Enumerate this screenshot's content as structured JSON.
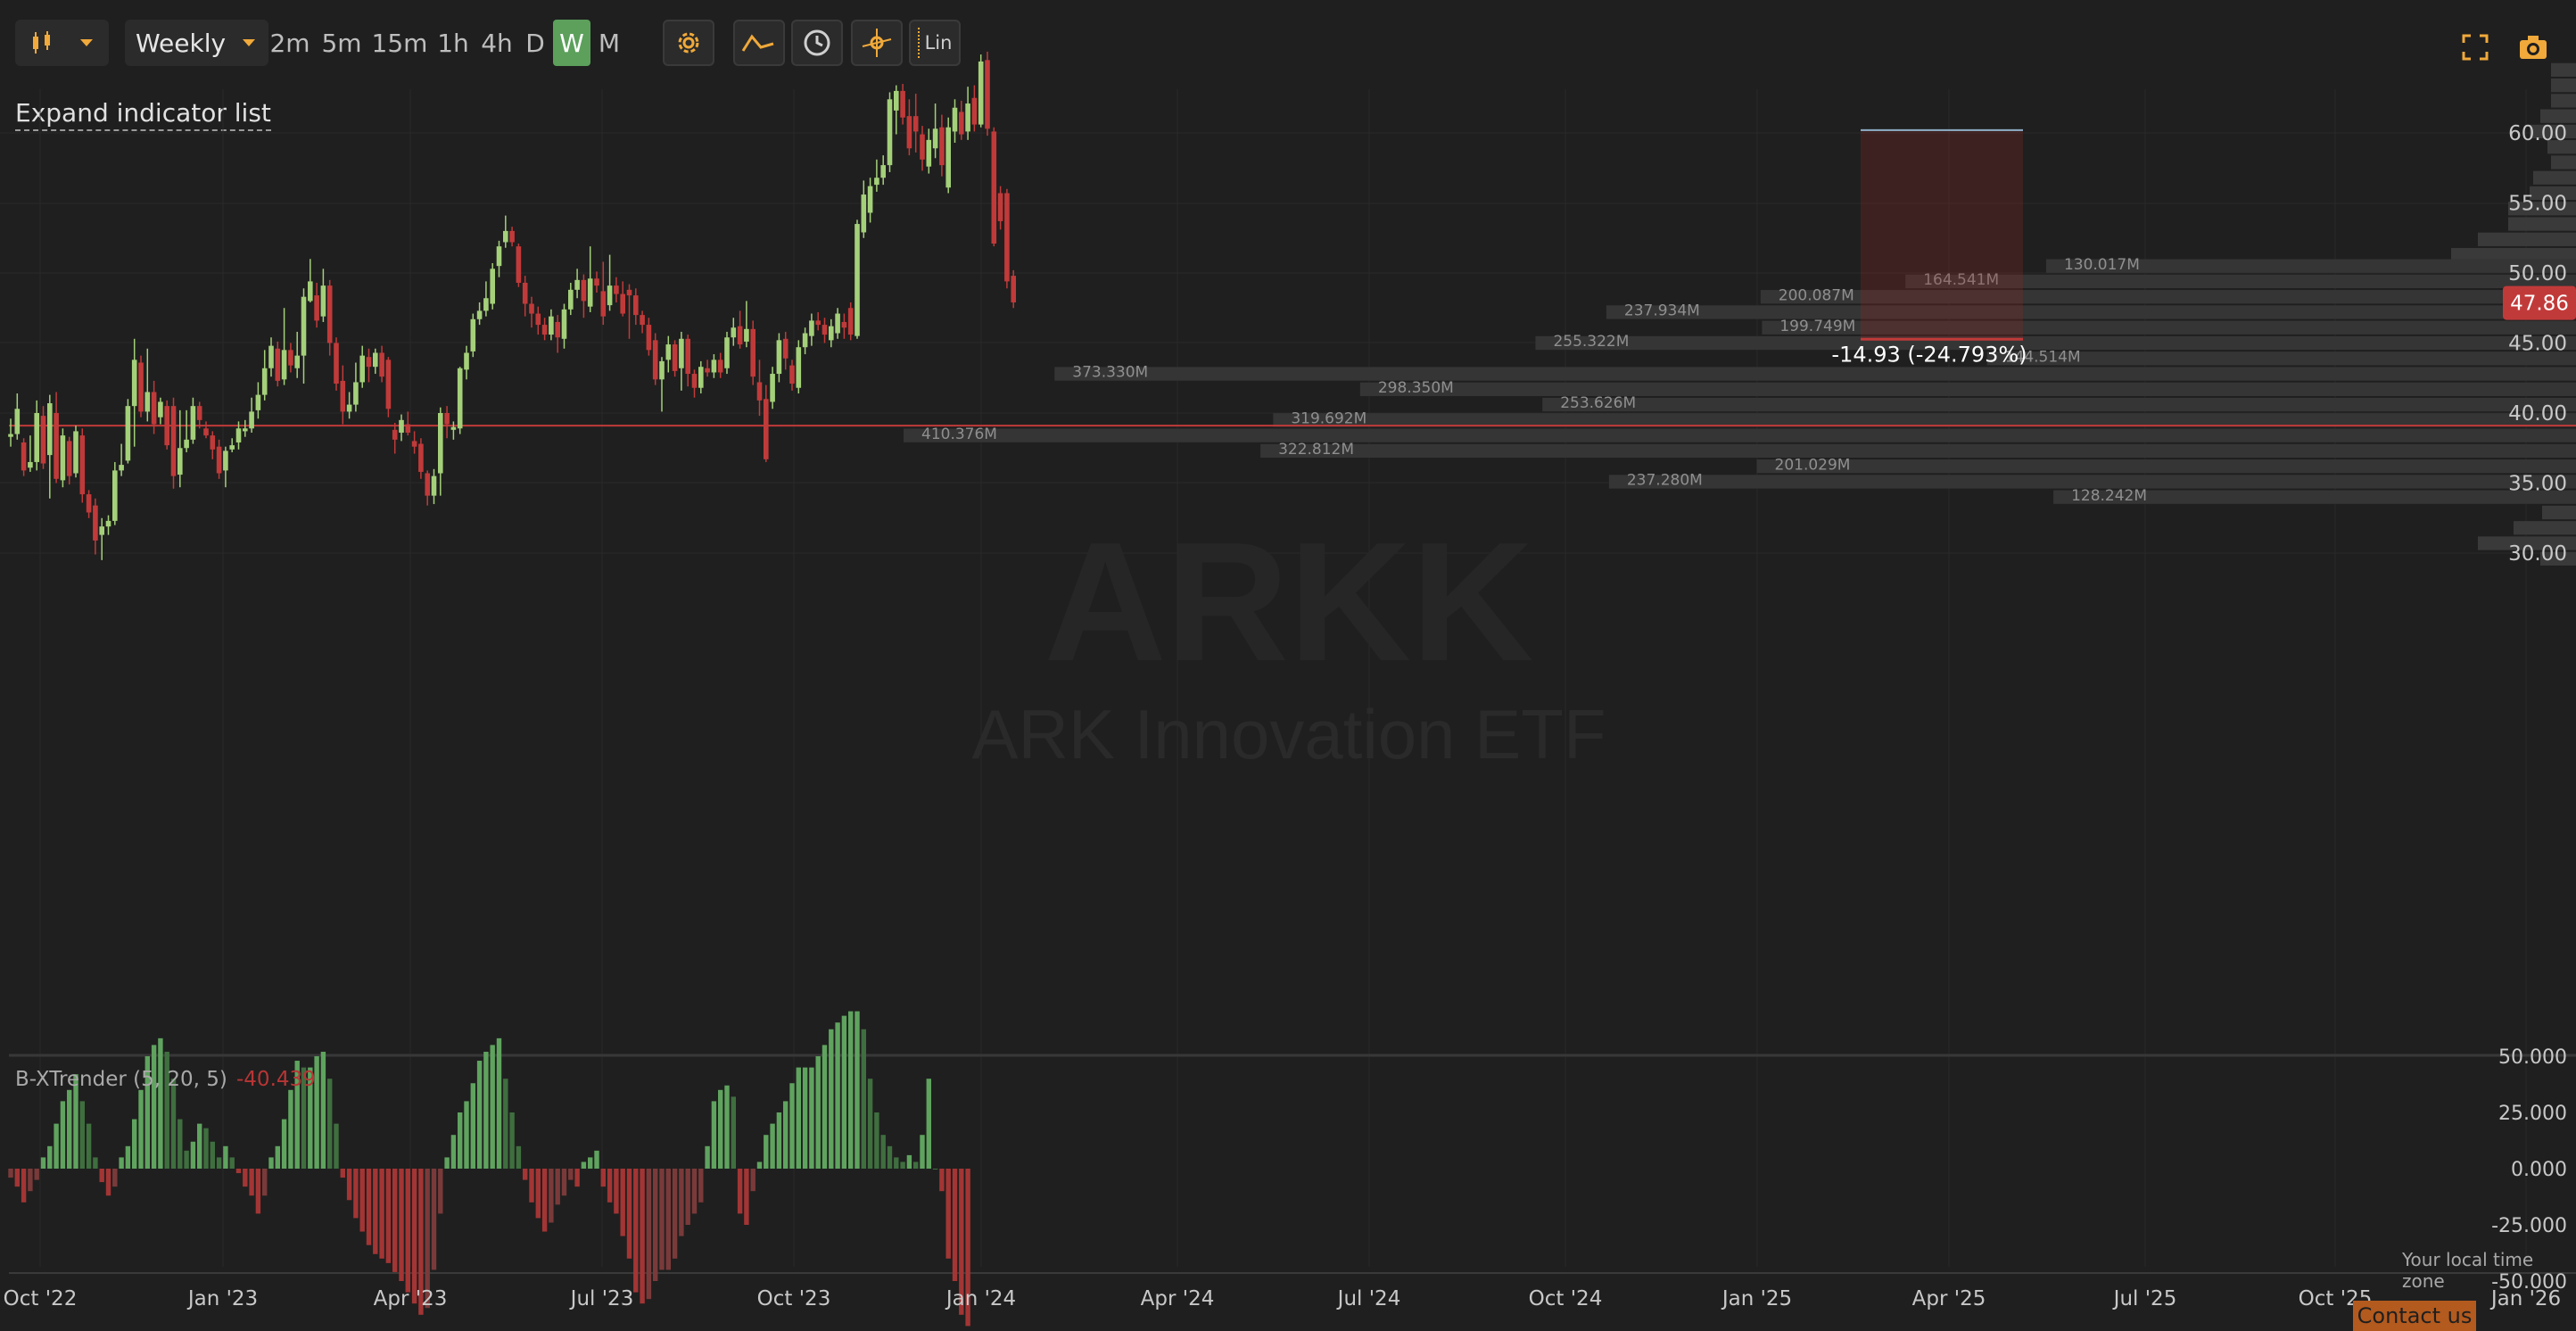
{
  "toolbar": {
    "interval_select": "Weekly",
    "intervals": [
      "2m",
      "5m",
      "15m",
      "1h",
      "4h",
      "D",
      "W",
      "M"
    ],
    "active_interval": "W",
    "scale_button": "Lin"
  },
  "expand_indicators_label": "Expand indicator list",
  "watermark": {
    "symbol": "ARKK",
    "name": "ARK Innovation ETF"
  },
  "price_axis": {
    "ticks": [
      "60.00",
      "55.00",
      "50.00",
      "45.00",
      "40.00",
      "35.00",
      "30.00"
    ]
  },
  "last_price": "47.86",
  "measure_label": "-14.93 (-24.793%)",
  "volume_profile_labels": [
    "130.017M",
    "164.541M",
    "200.087M",
    "237.934M",
    "199.749M",
    "255.322M",
    "144.514M",
    "373.330M",
    "298.350M",
    "253.626M",
    "319.692M",
    "410.376M",
    "322.812M",
    "201.029M",
    "237.280M",
    "128.242M"
  ],
  "indicator": {
    "label": "B-XTrender (5, 20, 5)",
    "value": "-40.439",
    "ticks": [
      "50.000",
      "25.000",
      "0.000",
      "-25.000",
      "-50.000"
    ]
  },
  "time_axis": [
    "Oct '22",
    "Jan '23",
    "Apr '23",
    "Jul '23",
    "Oct '23",
    "Jan '24",
    "Apr '24",
    "Jul '24",
    "Oct '24",
    "Jan '25",
    "Apr '25",
    "Jul '25",
    "Oct '25",
    "Jan '26"
  ],
  "timezone_label": "Your local time zone",
  "contact_label": "Contact us",
  "colors": {
    "up": "#a4d07a",
    "down": "#c13a3a",
    "bg": "#1f1f1f",
    "accent": "#f0a93a",
    "active": "#5ca05c"
  },
  "icons": [
    "candlestick-icon",
    "chevron-down-icon",
    "gear-icon",
    "draw-line-icon",
    "clock-icon",
    "crosshair-icon",
    "fullscreen-icon",
    "camera-icon"
  ],
  "chart_data": {
    "type": "candlestick",
    "interval": "weekly",
    "y_range": [
      29,
      64
    ],
    "weeks": [
      {
        "o": 38.3,
        "c": 38.5,
        "h": 39.6,
        "l": 37.6
      },
      {
        "o": 38.5,
        "c": 40.3,
        "h": 41.4,
        "l": 38.1
      },
      {
        "o": 37.9,
        "c": 35.9,
        "h": 38.2,
        "l": 35.5
      },
      {
        "o": 36.1,
        "c": 36.5,
        "h": 38.4,
        "l": 35.8
      },
      {
        "o": 36.5,
        "c": 40.0,
        "h": 40.9,
        "l": 35.9
      },
      {
        "o": 39.8,
        "c": 36.4,
        "h": 40.5,
        "l": 36.0
      },
      {
        "o": 37.0,
        "c": 40.7,
        "h": 41.3,
        "l": 33.9
      },
      {
        "o": 40.0,
        "c": 35.3,
        "h": 41.5,
        "l": 35.0
      },
      {
        "o": 35.2,
        "c": 38.4,
        "h": 38.9,
        "l": 34.7
      },
      {
        "o": 38.0,
        "c": 35.5,
        "h": 38.3,
        "l": 34.9
      },
      {
        "o": 35.7,
        "c": 38.7,
        "h": 39.1,
        "l": 35.4
      },
      {
        "o": 38.4,
        "c": 34.2,
        "h": 38.9,
        "l": 33.6
      },
      {
        "o": 34.2,
        "c": 32.9,
        "h": 34.5,
        "l": 32.5
      },
      {
        "o": 33.4,
        "c": 30.9,
        "h": 33.9,
        "l": 29.9
      },
      {
        "o": 31.3,
        "c": 31.9,
        "h": 32.5,
        "l": 29.5
      },
      {
        "o": 31.9,
        "c": 32.3,
        "h": 32.7,
        "l": 31.3
      },
      {
        "o": 32.3,
        "c": 35.9,
        "h": 36.5,
        "l": 32.0
      },
      {
        "o": 35.9,
        "c": 36.3,
        "h": 37.8,
        "l": 35.5
      },
      {
        "o": 36.6,
        "c": 40.5,
        "h": 41.0,
        "l": 36.4
      },
      {
        "o": 40.5,
        "c": 43.8,
        "h": 45.3,
        "l": 37.6
      },
      {
        "o": 43.6,
        "c": 40.1,
        "h": 44.1,
        "l": 39.7
      },
      {
        "o": 40.1,
        "c": 41.5,
        "h": 44.6,
        "l": 39.4
      },
      {
        "o": 41.5,
        "c": 39.2,
        "h": 42.3,
        "l": 38.5
      },
      {
        "o": 39.7,
        "c": 40.8,
        "h": 41.1,
        "l": 39.2
      },
      {
        "o": 40.5,
        "c": 37.7,
        "h": 40.9,
        "l": 37.4
      },
      {
        "o": 40.5,
        "c": 35.5,
        "h": 41.1,
        "l": 34.6
      },
      {
        "o": 35.6,
        "c": 37.5,
        "h": 40.2,
        "l": 34.7
      },
      {
        "o": 37.5,
        "c": 38.1,
        "h": 40.2,
        "l": 37.2
      },
      {
        "o": 38.1,
        "c": 40.5,
        "h": 41.1,
        "l": 37.8
      },
      {
        "o": 40.5,
        "c": 39.5,
        "h": 40.8,
        "l": 38.9
      },
      {
        "o": 38.9,
        "c": 38.4,
        "h": 39.4,
        "l": 38.2
      },
      {
        "o": 38.4,
        "c": 37.4,
        "h": 38.7,
        "l": 36.7
      },
      {
        "o": 37.6,
        "c": 35.7,
        "h": 38.1,
        "l": 35.3
      },
      {
        "o": 35.9,
        "c": 37.3,
        "h": 37.6,
        "l": 34.7
      },
      {
        "o": 37.4,
        "c": 37.7,
        "h": 38.2,
        "l": 37.2
      },
      {
        "o": 37.9,
        "c": 38.9,
        "h": 39.4,
        "l": 37.4
      },
      {
        "o": 38.7,
        "c": 38.9,
        "h": 39.5,
        "l": 38.3
      },
      {
        "o": 38.9,
        "c": 40.1,
        "h": 41.1,
        "l": 38.6
      },
      {
        "o": 40.2,
        "c": 41.3,
        "h": 42.2,
        "l": 39.6
      },
      {
        "o": 41.3,
        "c": 43.2,
        "h": 44.5,
        "l": 40.9
      },
      {
        "o": 43.2,
        "c": 44.8,
        "h": 45.4,
        "l": 42.6
      },
      {
        "o": 44.6,
        "c": 42.3,
        "h": 45.1,
        "l": 41.9
      },
      {
        "o": 42.4,
        "c": 44.5,
        "h": 47.5,
        "l": 42.0
      },
      {
        "o": 44.5,
        "c": 43.4,
        "h": 45.0,
        "l": 42.9
      },
      {
        "o": 43.2,
        "c": 44.1,
        "h": 45.8,
        "l": 42.5
      },
      {
        "o": 44.1,
        "c": 48.3,
        "h": 48.9,
        "l": 42.1
      },
      {
        "o": 48.0,
        "c": 49.4,
        "h": 51.0,
        "l": 47.9
      },
      {
        "o": 48.4,
        "c": 46.6,
        "h": 49.3,
        "l": 46.1
      },
      {
        "o": 46.9,
        "c": 49.1,
        "h": 50.3,
        "l": 46.5
      },
      {
        "o": 49.1,
        "c": 45.0,
        "h": 49.5,
        "l": 44.1
      },
      {
        "o": 45.0,
        "c": 42.1,
        "h": 45.4,
        "l": 41.6
      },
      {
        "o": 42.3,
        "c": 40.1,
        "h": 43.4,
        "l": 39.2
      },
      {
        "o": 40.1,
        "c": 40.6,
        "h": 41.5,
        "l": 39.6
      },
      {
        "o": 40.6,
        "c": 42.2,
        "h": 43.6,
        "l": 40.1
      },
      {
        "o": 42.2,
        "c": 44.1,
        "h": 44.8,
        "l": 41.8
      },
      {
        "o": 44.0,
        "c": 43.3,
        "h": 44.6,
        "l": 42.2
      },
      {
        "o": 43.3,
        "c": 44.3,
        "h": 44.6,
        "l": 42.8
      },
      {
        "o": 44.3,
        "c": 42.6,
        "h": 44.8,
        "l": 42.2
      },
      {
        "o": 43.8,
        "c": 40.3,
        "h": 44.0,
        "l": 39.7
      },
      {
        "o": 38.8,
        "c": 38.1,
        "h": 39.3,
        "l": 37.1
      },
      {
        "o": 38.6,
        "c": 39.5,
        "h": 39.9,
        "l": 38.0
      },
      {
        "o": 39.2,
        "c": 38.6,
        "h": 40.1,
        "l": 38.4
      },
      {
        "o": 38.0,
        "c": 37.6,
        "h": 38.7,
        "l": 37.1
      },
      {
        "o": 37.8,
        "c": 35.8,
        "h": 38.2,
        "l": 35.3
      },
      {
        "o": 35.7,
        "c": 34.1,
        "h": 35.9,
        "l": 33.4
      },
      {
        "o": 34.1,
        "c": 35.5,
        "h": 36.0,
        "l": 33.5
      },
      {
        "o": 35.7,
        "c": 40.0,
        "h": 40.4,
        "l": 34.1
      },
      {
        "o": 40.0,
        "c": 39.2,
        "h": 40.5,
        "l": 38.2
      },
      {
        "o": 38.8,
        "c": 39.0,
        "h": 39.4,
        "l": 38.1
      },
      {
        "o": 38.9,
        "c": 43.2,
        "h": 43.3,
        "l": 38.5
      },
      {
        "o": 43.1,
        "c": 44.3,
        "h": 44.8,
        "l": 42.4
      },
      {
        "o": 44.4,
        "c": 46.7,
        "h": 47.1,
        "l": 44.0
      },
      {
        "o": 46.7,
        "c": 47.3,
        "h": 47.9,
        "l": 46.3
      },
      {
        "o": 47.3,
        "c": 48.2,
        "h": 49.4,
        "l": 46.9
      },
      {
        "o": 47.8,
        "c": 50.3,
        "h": 50.7,
        "l": 47.4
      },
      {
        "o": 50.5,
        "c": 51.9,
        "h": 52.3,
        "l": 49.7
      },
      {
        "o": 52.2,
        "c": 53.0,
        "h": 54.1,
        "l": 51.8
      },
      {
        "o": 53.0,
        "c": 52.2,
        "h": 53.3,
        "l": 51.9
      },
      {
        "o": 51.9,
        "c": 49.3,
        "h": 52.1,
        "l": 49.0
      },
      {
        "o": 49.3,
        "c": 47.8,
        "h": 49.8,
        "l": 46.9
      },
      {
        "o": 47.8,
        "c": 47.1,
        "h": 48.3,
        "l": 46.1
      },
      {
        "o": 47.1,
        "c": 46.3,
        "h": 47.6,
        "l": 45.6
      },
      {
        "o": 46.3,
        "c": 45.6,
        "h": 46.8,
        "l": 45.2
      },
      {
        "o": 45.6,
        "c": 46.9,
        "h": 47.4,
        "l": 45.2
      },
      {
        "o": 46.5,
        "c": 45.4,
        "h": 47.0,
        "l": 44.3
      },
      {
        "o": 45.3,
        "c": 47.4,
        "h": 47.8,
        "l": 44.6
      },
      {
        "o": 47.4,
        "c": 48.8,
        "h": 49.3,
        "l": 47.0
      },
      {
        "o": 48.8,
        "c": 49.5,
        "h": 50.3,
        "l": 48.2
      },
      {
        "o": 49.5,
        "c": 48.0,
        "h": 49.9,
        "l": 46.8
      },
      {
        "o": 47.6,
        "c": 49.6,
        "h": 51.9,
        "l": 47.2
      },
      {
        "o": 49.6,
        "c": 49.1,
        "h": 50.1,
        "l": 48.6
      },
      {
        "o": 48.7,
        "c": 46.9,
        "h": 50.8,
        "l": 46.3
      },
      {
        "o": 47.7,
        "c": 49.1,
        "h": 51.3,
        "l": 47.3
      },
      {
        "o": 49.1,
        "c": 48.5,
        "h": 49.7,
        "l": 47.9
      },
      {
        "o": 48.5,
        "c": 47.1,
        "h": 49.4,
        "l": 46.9
      },
      {
        "o": 48.8,
        "c": 48.4,
        "h": 49.2,
        "l": 45.3
      },
      {
        "o": 48.4,
        "c": 47.0,
        "h": 48.9,
        "l": 46.3
      },
      {
        "o": 47.0,
        "c": 46.3,
        "h": 47.3,
        "l": 45.7
      },
      {
        "o": 46.3,
        "c": 44.5,
        "h": 46.8,
        "l": 44.1
      },
      {
        "o": 45.2,
        "c": 42.4,
        "h": 45.7,
        "l": 42.0
      },
      {
        "o": 42.4,
        "c": 43.7,
        "h": 44.0,
        "l": 40.1
      },
      {
        "o": 43.8,
        "c": 44.9,
        "h": 45.5,
        "l": 42.9
      },
      {
        "o": 44.9,
        "c": 43.0,
        "h": 45.2,
        "l": 42.6
      },
      {
        "o": 43.2,
        "c": 45.3,
        "h": 45.8,
        "l": 41.6
      },
      {
        "o": 45.3,
        "c": 42.8,
        "h": 45.6,
        "l": 41.9
      },
      {
        "o": 42.8,
        "c": 41.8,
        "h": 43.1,
        "l": 41.1
      },
      {
        "o": 41.8,
        "c": 43.3,
        "h": 43.7,
        "l": 41.4
      },
      {
        "o": 43.2,
        "c": 42.9,
        "h": 43.8,
        "l": 42.6
      },
      {
        "o": 42.9,
        "c": 43.8,
        "h": 44.2,
        "l": 42.5
      },
      {
        "o": 43.8,
        "c": 42.9,
        "h": 44.3,
        "l": 42.5
      },
      {
        "o": 43.2,
        "c": 45.4,
        "h": 45.8,
        "l": 42.8
      },
      {
        "o": 45.4,
        "c": 46.1,
        "h": 46.8,
        "l": 44.8
      },
      {
        "o": 46.2,
        "c": 44.9,
        "h": 47.3,
        "l": 44.6
      },
      {
        "o": 45.1,
        "c": 46.0,
        "h": 48.0,
        "l": 44.7
      },
      {
        "o": 46.0,
        "c": 42.6,
        "h": 46.6,
        "l": 42.0
      },
      {
        "o": 42.2,
        "c": 40.9,
        "h": 43.8,
        "l": 39.8
      },
      {
        "o": 41.0,
        "c": 36.7,
        "h": 42.0,
        "l": 36.5
      },
      {
        "o": 40.8,
        "c": 42.8,
        "h": 43.3,
        "l": 40.3
      },
      {
        "o": 42.8,
        "c": 45.2,
        "h": 45.7,
        "l": 42.2
      },
      {
        "o": 45.3,
        "c": 43.9,
        "h": 45.8,
        "l": 43.1
      },
      {
        "o": 43.4,
        "c": 42.1,
        "h": 43.8,
        "l": 41.6
      },
      {
        "o": 41.8,
        "c": 44.7,
        "h": 45.2,
        "l": 41.4
      },
      {
        "o": 44.7,
        "c": 45.7,
        "h": 46.1,
        "l": 44.2
      },
      {
        "o": 45.5,
        "c": 46.6,
        "h": 47.1,
        "l": 44.8
      },
      {
        "o": 46.6,
        "c": 46.3,
        "h": 47.2,
        "l": 45.9
      },
      {
        "o": 46.3,
        "c": 45.6,
        "h": 46.8,
        "l": 45.0
      },
      {
        "o": 45.2,
        "c": 46.2,
        "h": 46.7,
        "l": 44.7
      },
      {
        "o": 45.7,
        "c": 47.1,
        "h": 47.5,
        "l": 45.3
      },
      {
        "o": 46.5,
        "c": 46.1,
        "h": 47.1,
        "l": 45.3
      },
      {
        "o": 47.5,
        "c": 45.6,
        "h": 47.9,
        "l": 45.2
      },
      {
        "o": 45.5,
        "c": 53.5,
        "h": 53.8,
        "l": 45.3
      },
      {
        "o": 52.9,
        "c": 55.6,
        "h": 56.6,
        "l": 52.5
      },
      {
        "o": 54.3,
        "c": 56.2,
        "h": 56.8,
        "l": 53.6
      },
      {
        "o": 56.3,
        "c": 56.8,
        "h": 58.1,
        "l": 55.8
      },
      {
        "o": 56.8,
        "c": 57.7,
        "h": 58.4,
        "l": 56.3
      },
      {
        "o": 57.7,
        "c": 62.4,
        "h": 62.9,
        "l": 57.2
      },
      {
        "o": 61.6,
        "c": 63.0,
        "h": 63.4,
        "l": 59.9
      },
      {
        "o": 63.0,
        "c": 61.1,
        "h": 63.5,
        "l": 60.6
      },
      {
        "o": 61.2,
        "c": 58.9,
        "h": 62.4,
        "l": 58.4
      },
      {
        "o": 61.2,
        "c": 60.1,
        "h": 62.8,
        "l": 58.6
      },
      {
        "o": 59.9,
        "c": 58.1,
        "h": 60.5,
        "l": 57.3
      },
      {
        "o": 57.6,
        "c": 59.5,
        "h": 60.3,
        "l": 57.1
      },
      {
        "o": 58.9,
        "c": 60.3,
        "h": 62.1,
        "l": 58.2
      },
      {
        "o": 60.4,
        "c": 57.7,
        "h": 61.3,
        "l": 56.9
      },
      {
        "o": 56.1,
        "c": 60.4,
        "h": 61.1,
        "l": 55.7
      },
      {
        "o": 60.1,
        "c": 61.8,
        "h": 62.4,
        "l": 59.3
      },
      {
        "o": 61.5,
        "c": 59.9,
        "h": 62.3,
        "l": 59.5
      },
      {
        "o": 60.1,
        "c": 62.1,
        "h": 63.3,
        "l": 59.5
      },
      {
        "o": 62.5,
        "c": 60.6,
        "h": 63.4,
        "l": 60.1
      },
      {
        "o": 60.6,
        "c": 65.1,
        "h": 65.6,
        "l": 60.4
      },
      {
        "o": 65.2,
        "c": 60.3,
        "h": 65.8,
        "l": 59.8
      },
      {
        "o": 60.1,
        "c": 52.1,
        "h": 60.4,
        "l": 51.9
      },
      {
        "o": 55.7,
        "c": 53.7,
        "h": 56.2,
        "l": 53.1
      },
      {
        "o": 55.7,
        "c": 49.4,
        "h": 56.0,
        "l": 48.9
      },
      {
        "o": 49.8,
        "c": 47.9,
        "h": 50.2,
        "l": 47.5
      }
    ],
    "volume_profile": [
      {
        "price": 50.5,
        "volume": 130.017
      },
      {
        "price": 49.4,
        "volume": 164.541
      },
      {
        "price": 48.3,
        "volume": 200.087
      },
      {
        "price": 47.2,
        "volume": 237.934
      },
      {
        "price": 46.1,
        "volume": 199.749
      },
      {
        "price": 45.0,
        "volume": 255.322
      },
      {
        "price": 43.9,
        "volume": 144.514
      },
      {
        "price": 42.8,
        "volume": 373.33
      },
      {
        "price": 41.7,
        "volume": 298.35
      },
      {
        "price": 40.6,
        "volume": 253.626
      },
      {
        "price": 39.5,
        "volume": 319.692
      },
      {
        "price": 38.4,
        "volume": 410.376
      },
      {
        "price": 37.3,
        "volume": 322.812
      },
      {
        "price": 36.2,
        "volume": 201.029
      },
      {
        "price": 35.1,
        "volume": 237.28
      },
      {
        "price": 34.0,
        "volume": 128.242
      }
    ],
    "volume_profile_unlabeled": [
      {
        "price": 64.5,
        "volume": 2
      },
      {
        "price": 63.4,
        "volume": 3
      },
      {
        "price": 62.3,
        "volume": 10
      },
      {
        "price": 61.2,
        "volume": 20
      },
      {
        "price": 60.1,
        "volume": 26
      },
      {
        "price": 59.0,
        "volume": 16
      },
      {
        "price": 57.9,
        "volume": 11
      },
      {
        "price": 56.8,
        "volume": 24
      },
      {
        "price": 55.7,
        "volume": 26
      },
      {
        "price": 54.6,
        "volume": 38
      },
      {
        "price": 53.5,
        "volume": 38
      },
      {
        "price": 52.4,
        "volume": 55
      },
      {
        "price": 51.3,
        "volume": 70
      },
      {
        "price": 32.9,
        "volume": 19
      },
      {
        "price": 31.8,
        "volume": 35
      },
      {
        "price": 30.7,
        "volume": 55
      },
      {
        "price": 29.6,
        "volume": 20
      }
    ],
    "horizontal_line": 39.1,
    "measure": {
      "from_price": 60.2,
      "to_price": 45.27
    },
    "indicator_values": [
      -4,
      -8,
      -15,
      -10,
      -5,
      5,
      10,
      20,
      30,
      35,
      42,
      30,
      20,
      5,
      -6,
      -12,
      -8,
      5,
      10,
      22,
      35,
      50,
      55,
      58,
      52,
      40,
      22,
      8,
      12,
      20,
      18,
      12,
      5,
      10,
      5,
      -2,
      -8,
      -12,
      -20,
      -12,
      5,
      10,
      22,
      35,
      48,
      45,
      45,
      50,
      52,
      40,
      20,
      -4,
      -14,
      -22,
      -28,
      -34,
      -38,
      -40,
      -42,
      -46,
      -50,
      -55,
      -60,
      -65,
      -62,
      -45,
      -20,
      5,
      15,
      25,
      30,
      38,
      48,
      52,
      55,
      58,
      40,
      25,
      10,
      -5,
      -15,
      -22,
      -28,
      -24,
      -16,
      -12,
      -5,
      -8,
      3,
      5,
      8,
      -8,
      -15,
      -20,
      -30,
      -40,
      -55,
      -60,
      -58,
      -50,
      -45,
      -45,
      -40,
      -30,
      -25,
      -20,
      -15,
      10,
      30,
      35,
      37,
      32,
      -20,
      -25,
      -10,
      3,
      15,
      20,
      25,
      30,
      38,
      45,
      45,
      45,
      50,
      55,
      62,
      65,
      68,
      70,
      70,
      62,
      40,
      25,
      15,
      10,
      5,
      3,
      6,
      3,
      15,
      40,
      0,
      -10,
      -40,
      -50,
      -65,
      -70
    ],
    "indicator_range": [
      -50,
      50
    ]
  }
}
